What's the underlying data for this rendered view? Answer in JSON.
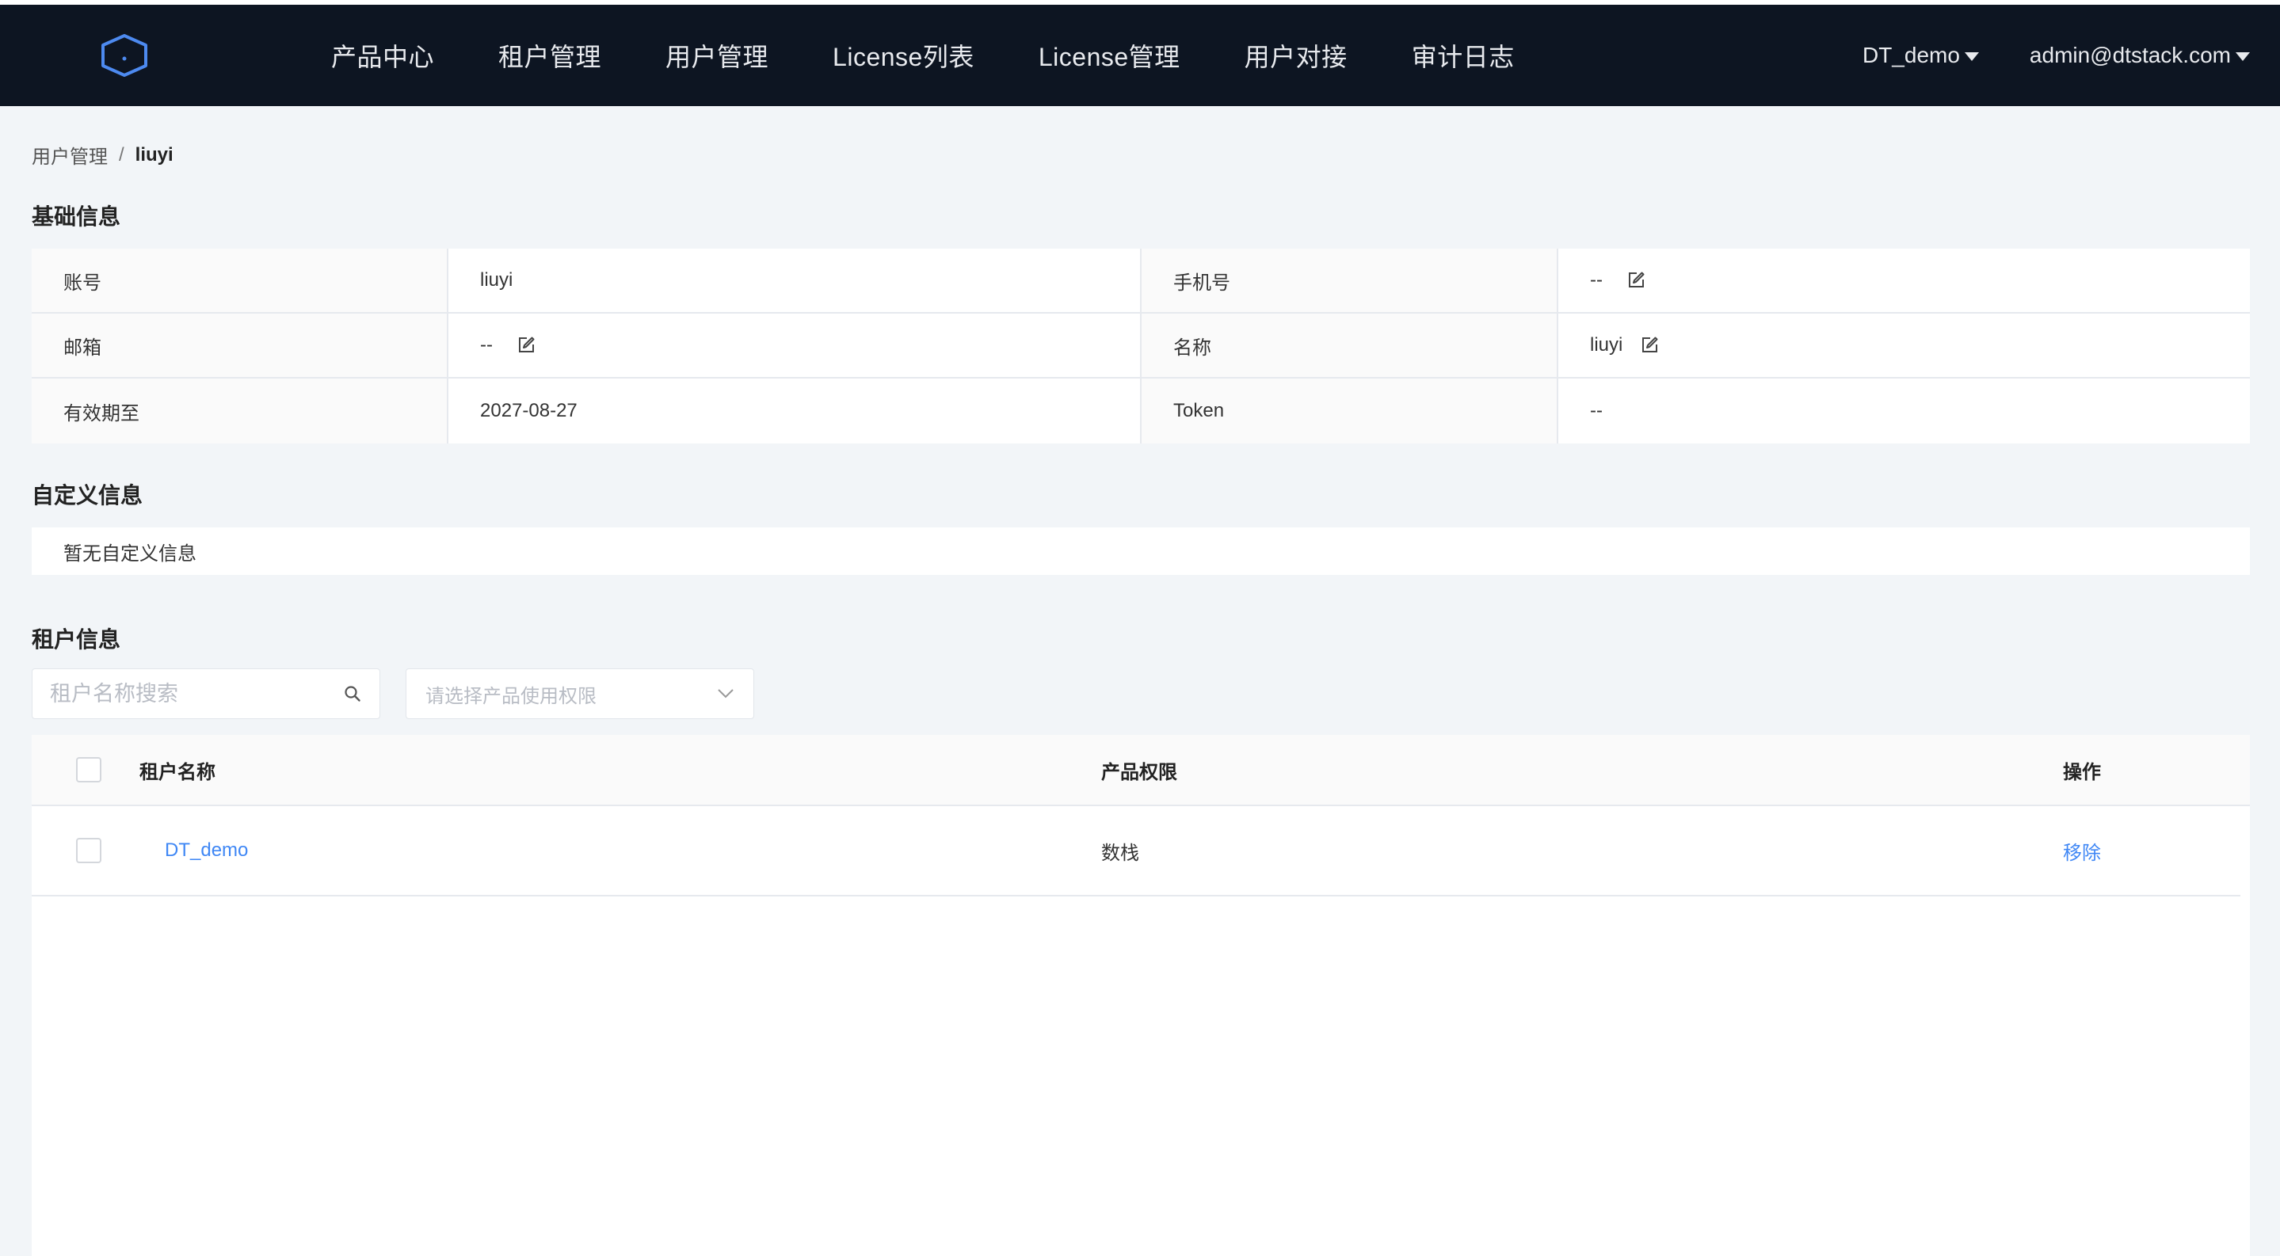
{
  "nav": {
    "items": [
      "产品中心",
      "租户管理",
      "用户管理",
      "License列表",
      "License管理",
      "用户对接",
      "审计日志"
    ],
    "tenant_dropdown": "DT_demo",
    "user_dropdown": "admin@dtstack.com"
  },
  "breadcrumb": {
    "parent": "用户管理",
    "separator": "/",
    "current": "liuyi"
  },
  "basic_info": {
    "title": "基础信息",
    "rows": [
      {
        "label1": "账号",
        "value1": "liuyi",
        "label2": "手机号",
        "value2": "--"
      },
      {
        "label1": "邮箱",
        "value1": "--",
        "label2": "名称",
        "value2": "liuyi"
      },
      {
        "label1": "有效期至",
        "value1": "2027-08-27",
        "label2": "Token",
        "value2": "--"
      }
    ]
  },
  "custom_info": {
    "title": "自定义信息",
    "empty_text": "暂无自定义信息"
  },
  "tenant_info": {
    "title": "租户信息",
    "search_placeholder": "租户名称搜索",
    "select_placeholder": "请选择产品使用权限",
    "columns": [
      "租户名称",
      "产品权限",
      "操作"
    ],
    "rows": [
      {
        "name": "DT_demo",
        "permission": "数栈",
        "action": "移除"
      }
    ]
  },
  "colors": {
    "nav_bg": "#0d1522",
    "link": "#3f87f5",
    "page_bg": "#f2f5f8"
  }
}
